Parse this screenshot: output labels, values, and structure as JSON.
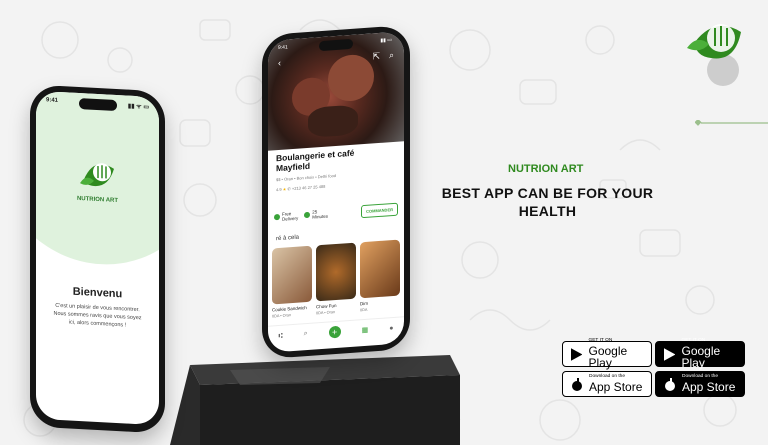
{
  "left_phone": {
    "time": "9:41",
    "status_icons": "▮▮ ᯤ ▭",
    "brand": "NUTRION ART",
    "welcome_title": "Bienvenu",
    "welcome_text": "C'est un plaisir de vous rencontrer. Nous sommes ravis que vous soyez ici, alors commençons !"
  },
  "right_phone": {
    "time": "9:41",
    "status_icons": "▮▮ ▭",
    "restaurant_name": "Boulangerie et café Mayfield",
    "meta_line": "$$ • Oran • Bon choix • Dethi food",
    "rating": "4.9",
    "phone": "+213 46 27 25 488",
    "delivery_label": "Free",
    "delivery_sub": "Delivery",
    "time_label": "25",
    "time_sub": "Minutes",
    "order_button": "COMMANDER",
    "section_title": "ré à cela",
    "items": [
      {
        "name": "Cookie Sandwich",
        "price": "0DA • Oran"
      },
      {
        "name": "Chow Fun",
        "price": "0DA • Oran"
      },
      {
        "name": "Dim",
        "price": "0DA"
      }
    ],
    "tab_home": "⑆",
    "tab_search": "⌕",
    "tab_plus": "+",
    "tab_menu": "▦",
    "tab_profile": "●"
  },
  "hero": {
    "brand": "NUTRION ART",
    "headline": "BEST APP CAN BE FOR YOUR HEALTH"
  },
  "stores": [
    {
      "small": "GET IT ON",
      "big": "Google Play",
      "style": "white"
    },
    {
      "small": "GET IT ON",
      "big": "Google Play",
      "style": "black"
    },
    {
      "small": "Download on the",
      "big": "App Store",
      "style": "white"
    },
    {
      "small": "Download on the",
      "big": "App Store",
      "style": "black"
    }
  ],
  "colors": {
    "brand_green": "#2f8a1f",
    "accent_green": "#3aa33a",
    "background": "#f3f3f3"
  }
}
